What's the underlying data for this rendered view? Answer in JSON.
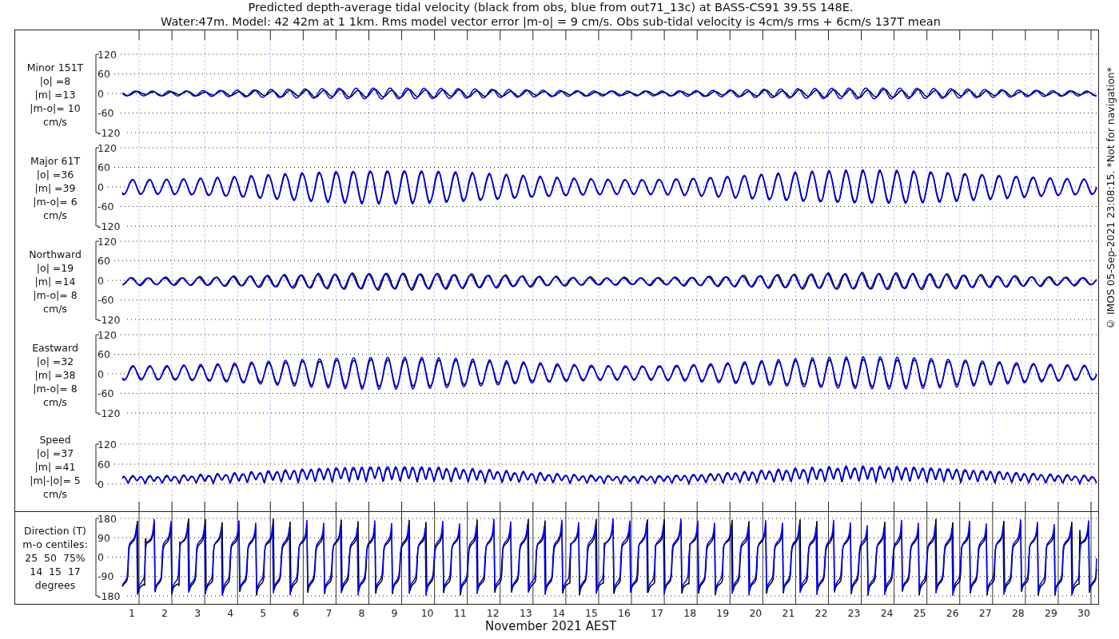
{
  "title": {
    "lines": [
      "Predicted depth-average tidal velocity (black from obs, blue from out71_13c) at BASS-CS91 39.5S 148E.",
      "Water:47m. Model: 42 42m at 1 1km. Rms model vector error |m-o| = 9 cm/s. Obs sub-tidal velocity is 4cm/s rms + 6cm/s 137T mean"
    ]
  },
  "panels": [
    {
      "kind": "minor",
      "label": [
        "Minor 151T",
        "|o| =8",
        "|m| =13",
        "|m-o|= 10",
        "cm/s"
      ],
      "yticks": [
        "120",
        "60",
        "0",
        "-60",
        "-120"
      ]
    },
    {
      "kind": "major",
      "label": [
        "Major 61T",
        "|o| =36",
        "|m| =39",
        "|m-o|= 6",
        "cm/s"
      ],
      "yticks": [
        "120",
        "60",
        "0",
        "-60",
        "-120"
      ]
    },
    {
      "kind": "northward",
      "label": [
        "Northward",
        "|o| =19",
        "|m| =14",
        "|m-o|= 8",
        "cm/s"
      ],
      "yticks": [
        "120",
        "60",
        "0",
        "-60",
        "-120"
      ]
    },
    {
      "kind": "eastward",
      "label": [
        "Eastward",
        "|o| =32",
        "|m| =38",
        "|m-o|= 8",
        "cm/s"
      ],
      "yticks": [
        "120",
        "60",
        "0",
        "-60",
        "-120"
      ]
    },
    {
      "kind": "speed",
      "label": [
        "Speed",
        "|o| =37",
        "|m| =41",
        "|m|-|o|= 5",
        "cm/s"
      ],
      "yticks": [
        "120",
        "60",
        "0"
      ]
    },
    {
      "kind": "direction",
      "label": [
        "Direction (T)",
        "m-o centiles:",
        "25  50  75%",
        "14  15  17",
        "degrees"
      ],
      "yticks": [
        "180",
        "90",
        "0",
        "-90",
        "-180"
      ]
    }
  ],
  "x_axis": {
    "day_labels": [
      "1",
      "2",
      "3",
      "4",
      "5",
      "6",
      "7",
      "8",
      "9",
      "10",
      "11",
      "12",
      "13",
      "14",
      "15",
      "16",
      "17",
      "18",
      "19",
      "20",
      "21",
      "22",
      "23",
      "24",
      "25",
      "26",
      "27",
      "28",
      "29",
      "30"
    ],
    "label": "November 2021 AEST"
  },
  "footer_note": "© IMOS 05-Sep-2021 23:08:15. *Not for navigation*"
}
